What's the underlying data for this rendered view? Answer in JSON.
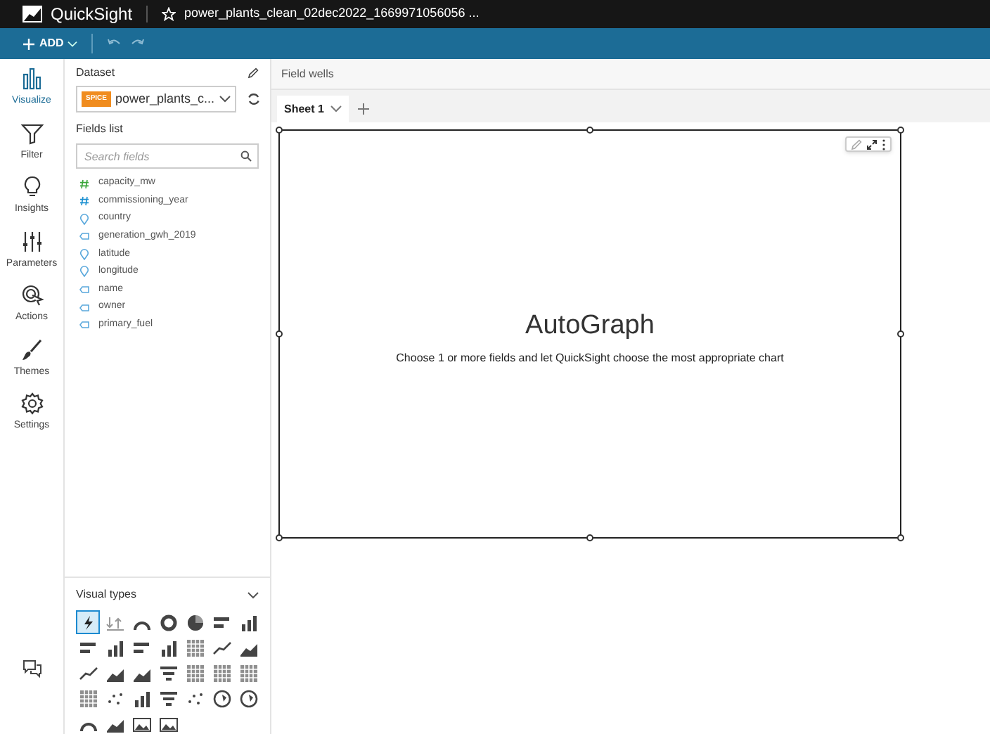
{
  "app": {
    "name": "QuickSight",
    "analysis_title": "power_plants_clean_02dec2022_1669971056056 ..."
  },
  "toolbar": {
    "add_label": "ADD"
  },
  "rail": [
    {
      "label": "Visualize",
      "selected": true
    },
    {
      "label": "Filter",
      "selected": false
    },
    {
      "label": "Insights",
      "selected": false
    },
    {
      "label": "Parameters",
      "selected": false
    },
    {
      "label": "Actions",
      "selected": false
    },
    {
      "label": "Themes",
      "selected": false
    },
    {
      "label": "Settings",
      "selected": false
    }
  ],
  "dataset": {
    "heading": "Dataset",
    "badge": "SPICE",
    "name": "power_plants_c..."
  },
  "fields": {
    "heading": "Fields list",
    "search_placeholder": "Search fields",
    "items": [
      {
        "name": "capacity_mw",
        "kind": "measure"
      },
      {
        "name": "commissioning_year",
        "kind": "number"
      },
      {
        "name": "country",
        "kind": "geo"
      },
      {
        "name": "generation_gwh_2019",
        "kind": "text"
      },
      {
        "name": "latitude",
        "kind": "geo"
      },
      {
        "name": "longitude",
        "kind": "geo"
      },
      {
        "name": "name",
        "kind": "text"
      },
      {
        "name": "owner",
        "kind": "text"
      },
      {
        "name": "primary_fuel",
        "kind": "text"
      }
    ]
  },
  "visual_types": {
    "heading": "Visual types",
    "items": [
      {
        "selected": true
      },
      {
        "selected": false
      },
      {
        "selected": false
      },
      {
        "selected": false
      },
      {
        "selected": false
      },
      {
        "selected": false
      },
      {
        "selected": false
      },
      {
        "selected": false
      },
      {
        "selected": false
      },
      {
        "selected": false
      },
      {
        "selected": false
      },
      {
        "selected": false
      },
      {
        "selected": false
      },
      {
        "selected": false
      },
      {
        "selected": false
      },
      {
        "selected": false
      },
      {
        "selected": false
      },
      {
        "selected": false
      },
      {
        "selected": false
      },
      {
        "selected": false
      },
      {
        "selected": false
      },
      {
        "selected": false
      },
      {
        "selected": false
      },
      {
        "selected": false
      },
      {
        "selected": false
      },
      {
        "selected": false
      },
      {
        "selected": false
      },
      {
        "selected": false
      },
      {
        "selected": false
      },
      {
        "selected": false
      },
      {
        "selected": false
      },
      {
        "selected": false
      }
    ]
  },
  "field_wells": {
    "label": "Field wells"
  },
  "sheets": [
    {
      "label": "Sheet 1",
      "selected": true
    }
  ],
  "visual": {
    "title": "AutoGraph",
    "hint": "Choose 1 or more fields and let QuickSight choose the most appropriate chart"
  }
}
